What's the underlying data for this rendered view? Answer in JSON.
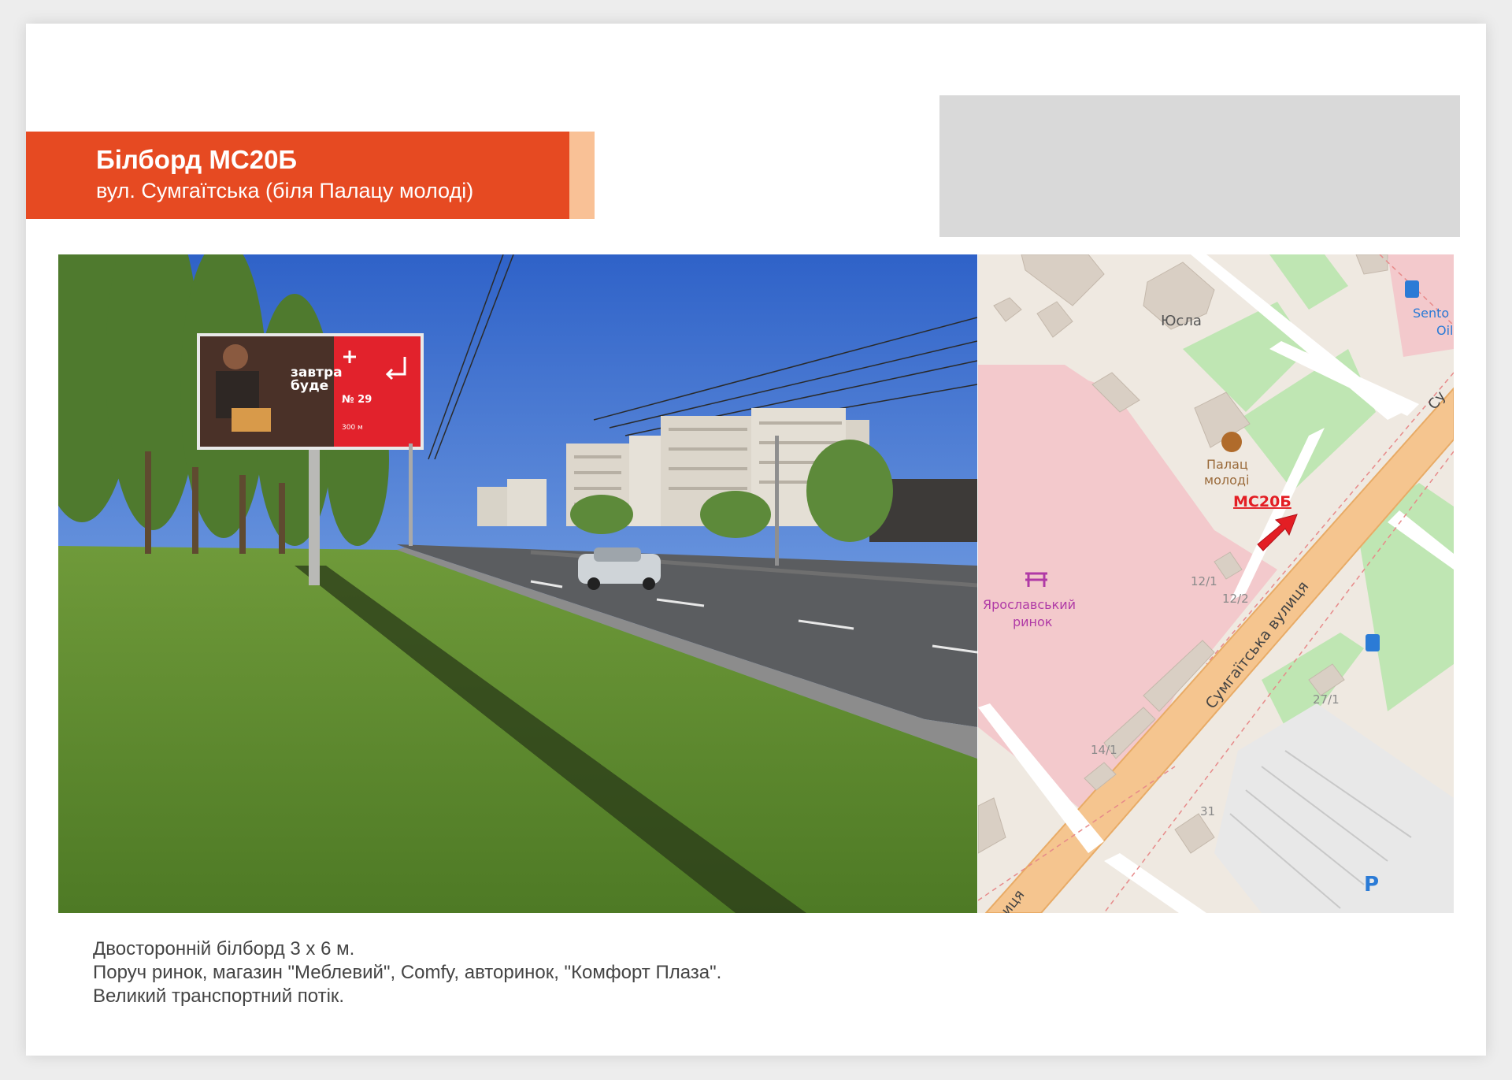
{
  "header": {
    "title": "Білборд МС20Б",
    "address": "вул. Сумгаїтська (біля Палацу молоді)"
  },
  "colors": {
    "accent": "#e64a22",
    "accent_light": "#f9c196",
    "placeholder": "#d9d9d9",
    "marker": "#e31e24"
  },
  "photo": {
    "billboard_ad": {
      "slogan_line1": "завтра",
      "slogan_line2": "буде",
      "branch": "№ 29",
      "distance": "300 м"
    }
  },
  "map": {
    "marker_label": "МС20Б",
    "street_name": "Сумгаїтська вулиця",
    "street_short_end": "Су",
    "street_short_start": "иця",
    "poi": {
      "yusla": "Юсла",
      "palace_line1": "Палац",
      "palace_line2": "молоді",
      "market_line1": "Ярославський",
      "market_line2": "ринок",
      "gas_line1": "Sento",
      "gas_line2": "Oil"
    },
    "house_numbers": [
      "12/1",
      "12/2",
      "14/1",
      "27/1",
      "31"
    ],
    "parking": "P"
  },
  "description": {
    "line1": "Двосторонній білборд 3 х 6 м.",
    "line2": "Поруч ринок, магазин \"Меблевий\", Comfy, авторинок, \"Комфорт Плаза\".",
    "line3": "Великий транспортний потік."
  }
}
